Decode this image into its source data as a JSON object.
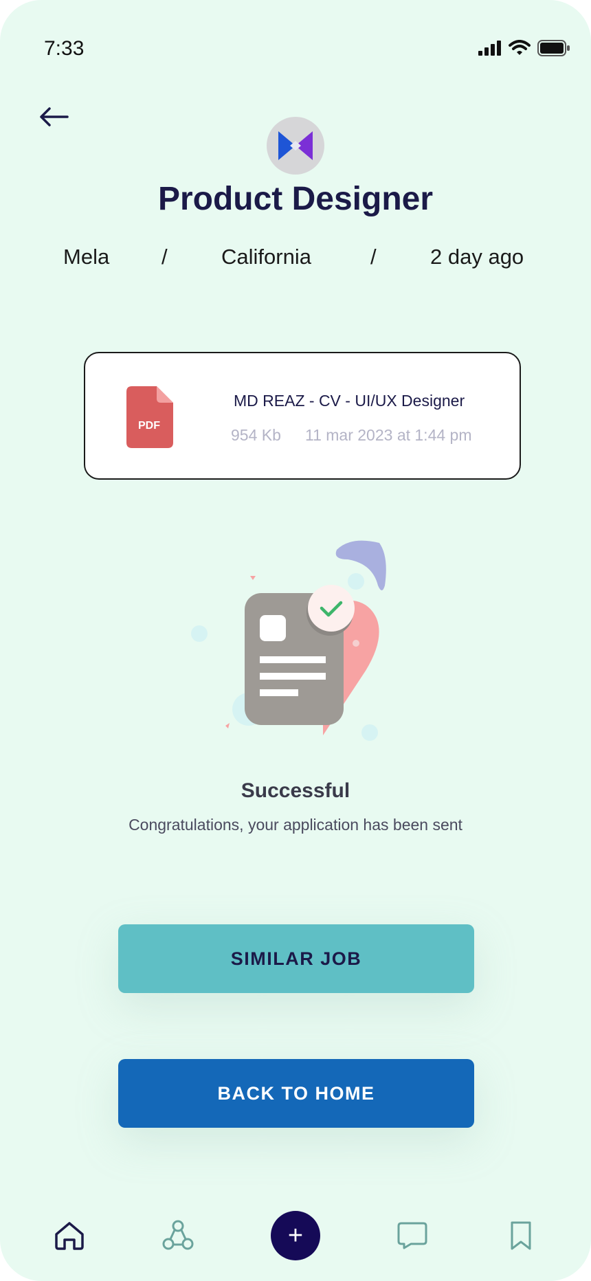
{
  "status_bar": {
    "time": "7:33"
  },
  "job": {
    "title": "Product Designer",
    "company": "Mela",
    "location": "California",
    "posted": "2 day ago",
    "separator": "/"
  },
  "attachment": {
    "file_type": "PDF",
    "file_name": "MD REAZ - CV - UI/UX Designer",
    "file_size": "954 Kb",
    "uploaded": "11 mar 2023 at 1:44 pm"
  },
  "result": {
    "title": "Successful",
    "message": "Congratulations, your application has been sent"
  },
  "buttons": {
    "similar_job": "SIMILAR JOB",
    "back_home": "BACK TO HOME"
  },
  "tabbar": {
    "items": [
      "home-icon",
      "community-icon",
      "add-icon",
      "chat-icon",
      "bookmark-icon"
    ],
    "add_symbol": "+"
  },
  "colors": {
    "background": "#e8faf1",
    "title": "#1b1a48",
    "similar_button": "#5fbfc5",
    "home_button": "#1468b8",
    "add_button": "#150a57",
    "pdf_red": "#d95d5d"
  }
}
